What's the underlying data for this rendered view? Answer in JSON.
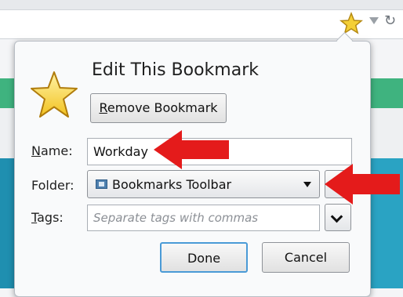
{
  "dialog": {
    "title": "Edit This Bookmark",
    "remove_button": {
      "mnemonic": "R",
      "rest": "emove Bookmark"
    },
    "name": {
      "label_mnemonic": "N",
      "label_rest": "ame:",
      "value": "Workday"
    },
    "folder": {
      "label": "Folder:",
      "selected": "Bookmarks Toolbar"
    },
    "tags": {
      "label_mnemonic": "T",
      "label_rest": "ags:",
      "placeholder": "Separate tags with commas"
    },
    "done_label": "Done",
    "cancel_label": "Cancel"
  },
  "icons": {
    "toolbar": [
      "bookmark-star-icon",
      "dropdown-triangle-icon",
      "reload-icon"
    ],
    "dialog": [
      "bookmark-star-icon",
      "folder-icon",
      "chevron-down-icon"
    ],
    "annotations": [
      "red-arrow-icon"
    ]
  },
  "colors": {
    "star_yellow": "#f4cf35",
    "arrow_red": "#e41b1b",
    "focus_blue": "#4a9ad6"
  }
}
